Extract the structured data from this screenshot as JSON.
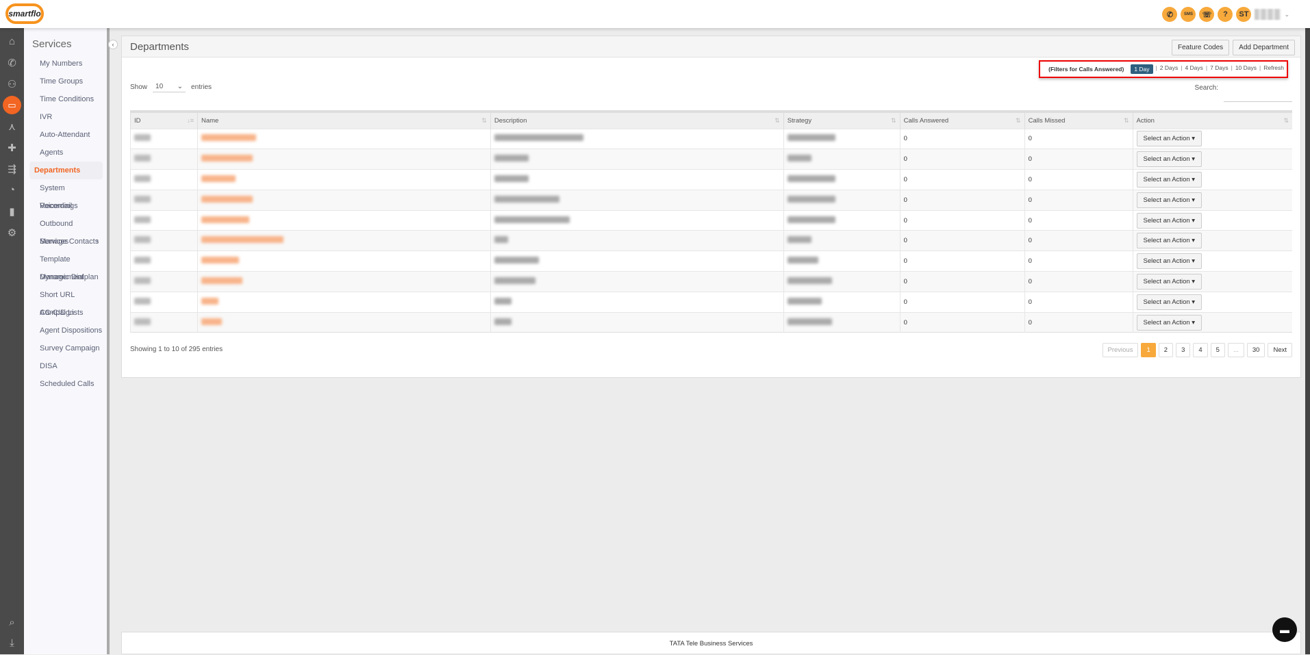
{
  "app": {
    "logo_text": "smartflo"
  },
  "topbar": {
    "icons": [
      "phone-icon",
      "sms-icon",
      "phone-ring-icon",
      "help-icon"
    ],
    "sms_label": "SMS",
    "help_label": "?",
    "avatar_initials": "ST"
  },
  "rail": {
    "icons": [
      "home-icon",
      "phone-icon",
      "users-icon",
      "services-icon",
      "network-icon",
      "integrations-icon",
      "routing-icon",
      "reports-pie-icon",
      "analytics-bar-icon",
      "settings-gear-icon"
    ],
    "bottom_icons": [
      "search-icon",
      "download-icon"
    ],
    "active": "services-icon"
  },
  "sidebar": {
    "title": "Services",
    "items": [
      {
        "label": "My Numbers"
      },
      {
        "label": "Time Groups"
      },
      {
        "label": "Time Conditions"
      },
      {
        "label": "IVR"
      },
      {
        "label": "Auto-Attendant"
      },
      {
        "label": "Agents"
      },
      {
        "label": "Departments",
        "active": true
      },
      {
        "label": "System Recordings"
      },
      {
        "label": "Voicemail"
      },
      {
        "label": "Outbound Services",
        "has_submenu": true
      },
      {
        "label": "Manage Contacts"
      },
      {
        "label": "Template Management"
      },
      {
        "label": "Dynamic Dialplan"
      },
      {
        "label": "Short URL Campaign"
      },
      {
        "label": "AC-CID Lists"
      },
      {
        "label": "Agent Dispositions"
      },
      {
        "label": "Survey Campaign"
      },
      {
        "label": "DISA"
      },
      {
        "label": "Scheduled Calls"
      }
    ]
  },
  "panel": {
    "title": "Departments",
    "buttons": {
      "feature_codes": "Feature Codes",
      "add_department": "Add Department"
    }
  },
  "filters": {
    "label": "(Filters for Calls Answered)",
    "options": [
      "1 Day",
      "2 Days",
      "4 Days",
      "7 Days",
      "10 Days",
      "Refresh"
    ],
    "selected": "1 Day"
  },
  "length": {
    "show": "Show",
    "value": "10",
    "entries": "entries"
  },
  "search": {
    "label": "Search:",
    "value": ""
  },
  "table": {
    "columns": [
      "ID",
      "Name",
      "Description",
      "Strategy",
      "Calls Answered",
      "Calls Missed",
      "Action"
    ],
    "rows": [
      {
        "calls_answered": "0",
        "calls_missed": "0",
        "action": "Select an Action"
      },
      {
        "calls_answered": "0",
        "calls_missed": "0",
        "action": "Select an Action"
      },
      {
        "calls_answered": "0",
        "calls_missed": "0",
        "action": "Select an Action"
      },
      {
        "calls_answered": "0",
        "calls_missed": "0",
        "action": "Select an Action"
      },
      {
        "calls_answered": "0",
        "calls_missed": "0",
        "action": "Select an Action"
      },
      {
        "calls_answered": "0",
        "calls_missed": "0",
        "action": "Select an Action"
      },
      {
        "calls_answered": "0",
        "calls_missed": "0",
        "action": "Select an Action"
      },
      {
        "calls_answered": "0",
        "calls_missed": "0",
        "action": "Select an Action"
      },
      {
        "calls_answered": "0",
        "calls_missed": "0",
        "action": "Select an Action"
      },
      {
        "calls_answered": "0",
        "calls_missed": "0",
        "action": "Select an Action"
      }
    ]
  },
  "info": "Showing 1 to 10 of 295 entries",
  "pagination": {
    "previous": "Previous",
    "pages": [
      "1",
      "2",
      "3",
      "4",
      "5",
      "...",
      "30"
    ],
    "current": "1",
    "next": "Next"
  },
  "footer": "TATA Tele Business Services",
  "colors": {
    "accent": "#f26522",
    "highlight": "#f7a93b",
    "filter_active": "#2f5f7f",
    "rail": "#4a4a4a"
  }
}
